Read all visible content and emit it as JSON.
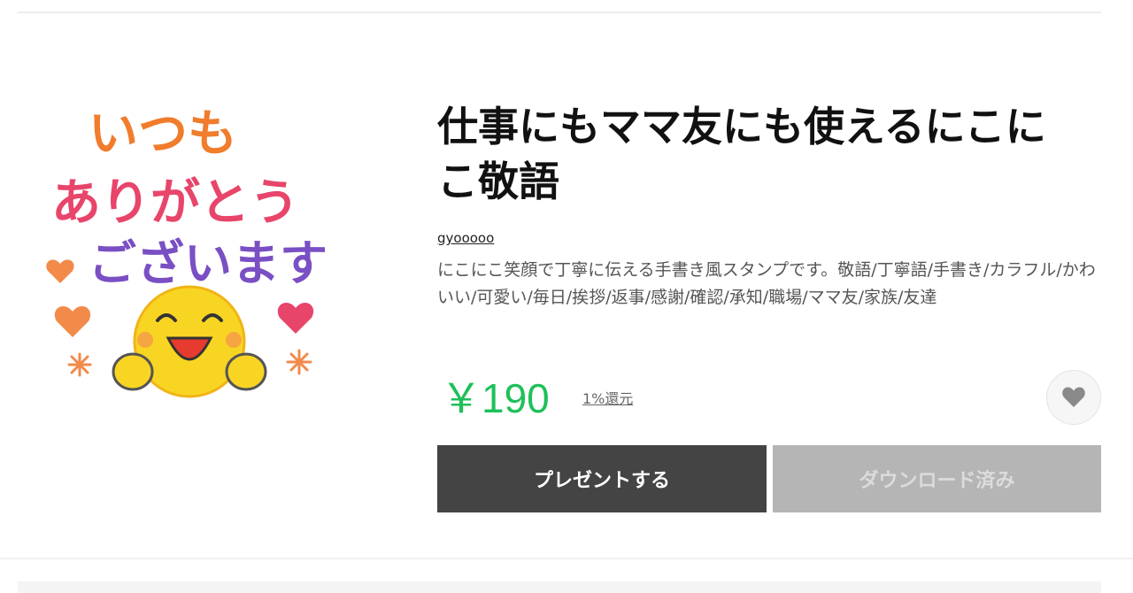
{
  "sticker": {
    "lines": [
      "いつも",
      "ありがとう",
      "ございます"
    ]
  },
  "product": {
    "title": "仕事にもママ友にも使えるにこにこ敬語",
    "author": "gyooooo",
    "description": "にこにこ笑顔で丁寧に伝える手書き風スタンプです。敬語/丁寧語/手書き/カラフル/かわいい/可愛い/毎日/挨拶/返事/感謝/確認/承知/職場/ママ友/家族/友達",
    "price": "￥190",
    "cashback": "1%還元"
  },
  "actions": {
    "present_label": "プレゼントする",
    "downloaded_label": "ダウンロード済み"
  },
  "colors": {
    "price": "#1ec05a",
    "present_button": "#444444",
    "downloaded_button": "#b5b5b5"
  },
  "icons": {
    "favorite": "heart-icon"
  }
}
